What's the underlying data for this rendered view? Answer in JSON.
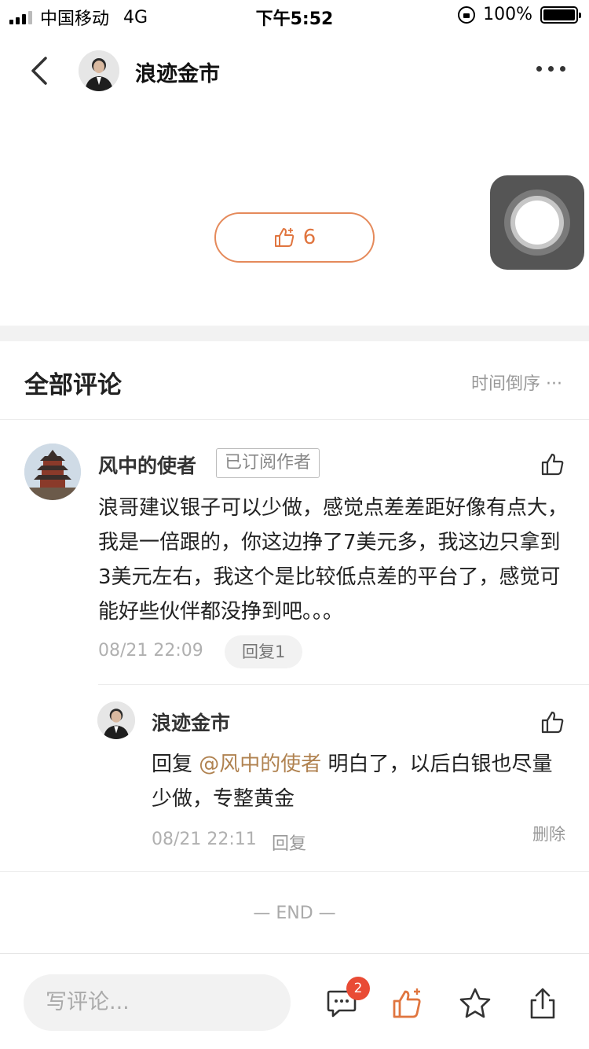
{
  "status_bar": {
    "carrier": "中国移动",
    "network": "4G",
    "time": "下午5:52",
    "battery": "100%"
  },
  "nav": {
    "title": "浪迹金市"
  },
  "article": {
    "like_count": "6"
  },
  "comments_section": {
    "title": "全部评论",
    "sort_label": "时间倒序 ···"
  },
  "comment": {
    "author": "风中的使者",
    "badge": "已订阅作者",
    "text": "浪哥建议银子可以少做，感觉点差差距好像有点大，我是一倍跟的，你这边挣了7美元多，我这边只拿到3美元左右，我这个是比较低点差的平台了，感觉可能好些伙伴都没挣到吧。。。",
    "date": "08/21 22:09",
    "reply_button": "回复1"
  },
  "reply": {
    "author": "浪迹金市",
    "prefix": "回复",
    "mention": "@风中的使者",
    "text": " 明白了，以后白银也尽量少做，专整黄金",
    "date": "08/21 22:11",
    "reply_link": "回复",
    "delete_link": "删除"
  },
  "end_label": "— END —",
  "bottom_bar": {
    "input_placeholder": "写评论...",
    "comment_badge": "2"
  },
  "colors": {
    "accent": "#e0753f",
    "mention": "#b08250",
    "badge": "#e94b35"
  }
}
